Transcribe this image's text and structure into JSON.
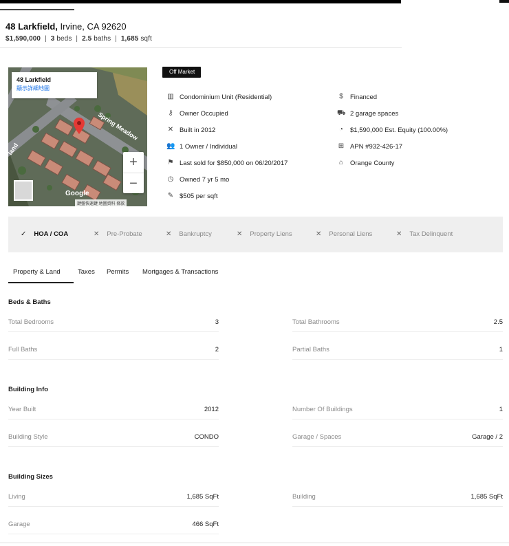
{
  "header": {
    "street": "48 Larkfield,",
    "city_state_zip": " Irvine, CA 92620",
    "price": "$1,590,000",
    "beds_num": "3",
    "beds_label": "beds",
    "baths_num": "2.5",
    "baths_label": "baths",
    "sqft_num": "1,685",
    "sqft_label": "sqft",
    "sep": "|"
  },
  "map": {
    "label_title": "48 Larkfield",
    "label_link": "顯示詳細地圖",
    "street_label_1": "Spring Meadow",
    "street_label_2": "land",
    "zoom_in": "+",
    "zoom_out": "−",
    "brand": "Google",
    "footer": "鍵盤快速鍵  地圖資料  條款"
  },
  "status_badge": "Off Market",
  "details_left": [
    {
      "icon": "building-icon",
      "glyph": "▥",
      "text": "Condominium Unit (Residential)"
    },
    {
      "icon": "key-icon",
      "glyph": "⚷",
      "text": "Owner Occupied"
    },
    {
      "icon": "tools-icon",
      "glyph": "✕",
      "text": "Built in 2012"
    },
    {
      "icon": "people-icon",
      "glyph": "👥",
      "text": "1 Owner / Individual"
    },
    {
      "icon": "flag-icon",
      "glyph": "⚑",
      "text": "Last sold for $850,000 on 06/20/2017"
    },
    {
      "icon": "clock-icon",
      "glyph": "◷",
      "text": "Owned 7 yr 5 mo"
    },
    {
      "icon": "ruler-icon",
      "glyph": "✎",
      "text": "$505 per sqft"
    }
  ],
  "details_right": [
    {
      "icon": "dollar-icon",
      "glyph": "$",
      "text": "Financed"
    },
    {
      "icon": "car-icon",
      "glyph": "⛟",
      "text": "2 garage spaces"
    },
    {
      "icon": "equity-icon",
      "glyph": "◔",
      "text": "$1,590,000 Est. Equity (100.00%)"
    },
    {
      "icon": "grid-icon",
      "glyph": "⊞",
      "text": "APN #932-426-17"
    },
    {
      "icon": "county-icon",
      "glyph": "⌂",
      "text": "Orange County"
    }
  ],
  "filters": [
    {
      "mark": "✓",
      "label": "HOA / COA",
      "active": true
    },
    {
      "mark": "✕",
      "label": "Pre-Probate",
      "active": false
    },
    {
      "mark": "✕",
      "label": "Bankruptcy",
      "active": false
    },
    {
      "mark": "✕",
      "label": "Property Liens",
      "active": false
    },
    {
      "mark": "✕",
      "label": "Personal Liens",
      "active": false
    },
    {
      "mark": "✕",
      "label": "Tax Delinquent",
      "active": false
    }
  ],
  "tabs": [
    {
      "label": "Property & Land",
      "active": true
    },
    {
      "label": "Taxes",
      "active": false
    },
    {
      "label": "Permits",
      "active": false
    },
    {
      "label": "Mortgages & Transactions",
      "active": false
    }
  ],
  "sections": {
    "beds_baths": {
      "title": "Beds & Baths",
      "rows": [
        {
          "left_key": "Total Bedrooms",
          "left_val": "3",
          "right_key": "Total Bathrooms",
          "right_val": "2.5"
        },
        {
          "left_key": "Full Baths",
          "left_val": "2",
          "right_key": "Partial Baths",
          "right_val": "1"
        }
      ]
    },
    "building_info": {
      "title": "Building Info",
      "rows": [
        {
          "left_key": "Year Built",
          "left_val": "2012",
          "right_key": "Number Of Buildings",
          "right_val": "1"
        },
        {
          "left_key": "Building Style",
          "left_val": "CONDO",
          "right_key": "Garage / Spaces",
          "right_val": "Garage / 2"
        }
      ]
    },
    "building_sizes": {
      "title": "Building Sizes",
      "rows": [
        {
          "left_key": "Living",
          "left_val": "1,685 SqFt",
          "right_key": "Building",
          "right_val": "1,685 SqFt"
        },
        {
          "left_key": "Garage",
          "left_val": "466 SqFt"
        }
      ]
    }
  }
}
